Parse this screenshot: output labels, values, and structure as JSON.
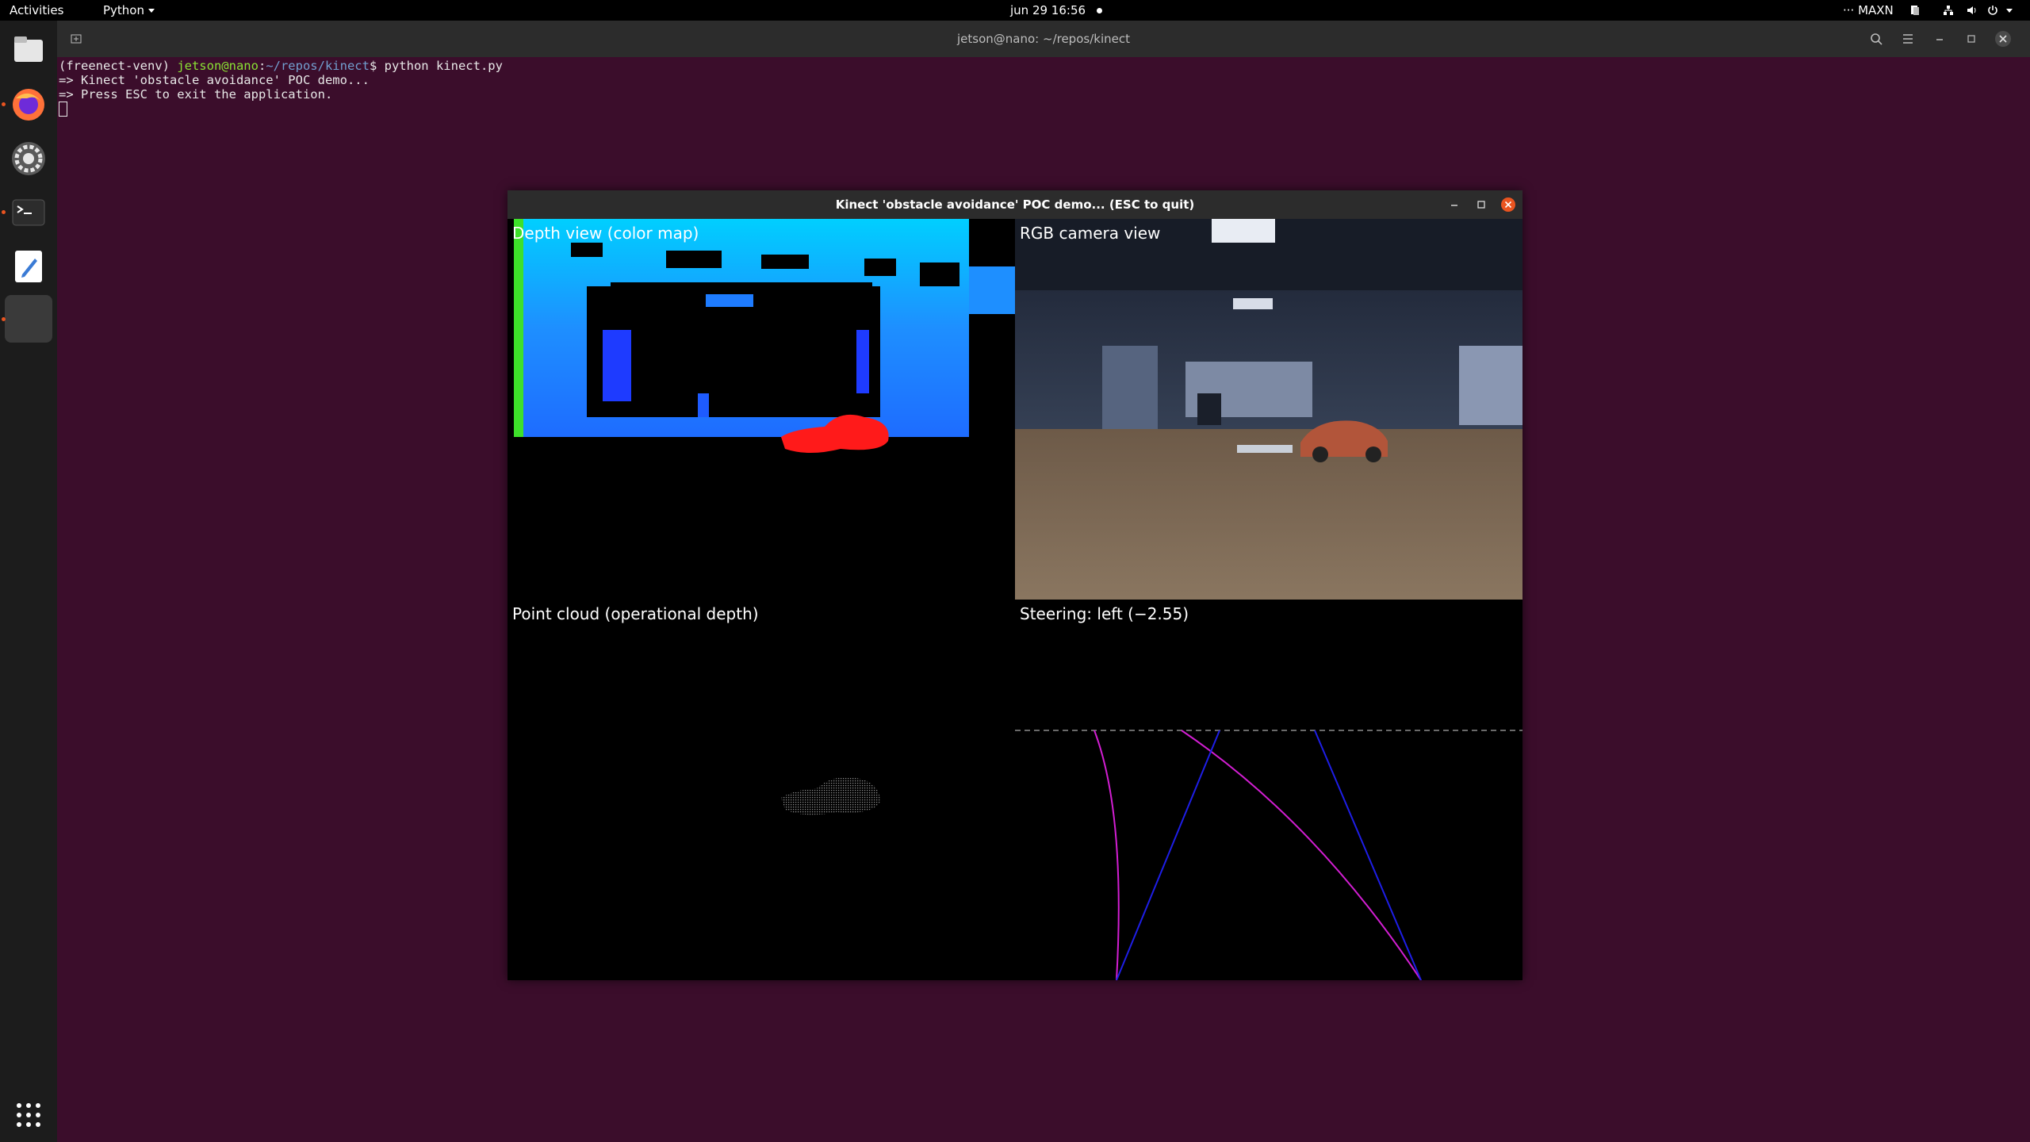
{
  "topbar": {
    "activities": "Activities",
    "app_menu": "Python",
    "clock": "jun 29  16:56",
    "power_mode": "MAXN"
  },
  "dock": {
    "items": [
      {
        "name": "files-icon"
      },
      {
        "name": "firefox-icon"
      },
      {
        "name": "settings-icon"
      },
      {
        "name": "terminal-icon"
      },
      {
        "name": "text-editor-icon"
      },
      {
        "name": "active-window-icon"
      }
    ],
    "show_apps": "show-applications-icon"
  },
  "terminal": {
    "title": "jetson@nano: ~/repos/kinect",
    "prompt_env": "(freenect-venv) ",
    "prompt_user": "jetson@nano",
    "prompt_sep": ":",
    "prompt_path": "~/repos/kinect",
    "prompt_cmd": "$ python kinect.py",
    "output": [
      "=> Kinect 'obstacle avoidance' POC demo...",
      "=> Press ESC to exit the application."
    ]
  },
  "app_window": {
    "title": "Kinect 'obstacle avoidance' POC demo... (ESC to quit)",
    "panes": {
      "depth": "Depth view (color map)",
      "rgb": "RGB camera view",
      "pointcloud": "Point cloud (operational depth)",
      "steering": "Steering: left (−2.55)"
    }
  },
  "colors": {
    "desktop": "#3b0d2b",
    "accent": "#e95420",
    "depth_blue": "#1e78ff",
    "depth_cyan": "#00c8ff",
    "obstacle_red": "#ff1a1a",
    "steer_magenta": "#d21ed2",
    "steer_blue": "#1e1ee6"
  }
}
